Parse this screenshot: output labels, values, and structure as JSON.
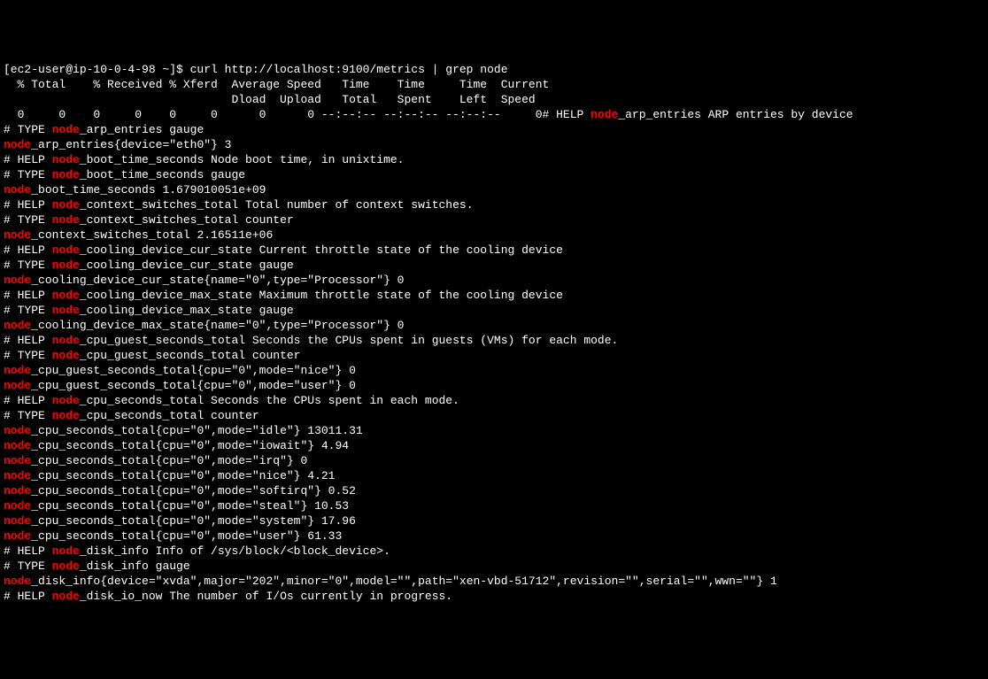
{
  "prompt": "[ec2-user@ip-10-0-4-98 ~]$ curl http://localhost:9100/metrics | grep node",
  "curl_headers": [
    "  % Total    % Received % Xferd  Average Speed   Time    Time     Time  Current",
    "                                 Dload  Upload   Total   Spent    Left  Speed"
  ],
  "curl_progress_left": "  0     0    0     0    0     0      0      0 --:--:-- --:--:-- --:--:--     0",
  "curl_progress_right_pre": "# HELP ",
  "curl_progress_right_post": "_arp_entries ARP entries by device",
  "lines": [
    {
      "pre": "# TYPE ",
      "hl": "node",
      "post": "_arp_entries gauge"
    },
    {
      "pre": "",
      "hl": "node",
      "post": "_arp_entries{device=\"eth0\"} 3"
    },
    {
      "pre": "# HELP ",
      "hl": "node",
      "post": "_boot_time_seconds Node boot time, in unixtime."
    },
    {
      "pre": "# TYPE ",
      "hl": "node",
      "post": "_boot_time_seconds gauge"
    },
    {
      "pre": "",
      "hl": "node",
      "post": "_boot_time_seconds 1.679010051e+09"
    },
    {
      "pre": "# HELP ",
      "hl": "node",
      "post": "_context_switches_total Total number of context switches."
    },
    {
      "pre": "# TYPE ",
      "hl": "node",
      "post": "_context_switches_total counter"
    },
    {
      "pre": "",
      "hl": "node",
      "post": "_context_switches_total 2.16511e+06"
    },
    {
      "pre": "# HELP ",
      "hl": "node",
      "post": "_cooling_device_cur_state Current throttle state of the cooling device"
    },
    {
      "pre": "# TYPE ",
      "hl": "node",
      "post": "_cooling_device_cur_state gauge"
    },
    {
      "pre": "",
      "hl": "node",
      "post": "_cooling_device_cur_state{name=\"0\",type=\"Processor\"} 0"
    },
    {
      "pre": "# HELP ",
      "hl": "node",
      "post": "_cooling_device_max_state Maximum throttle state of the cooling device"
    },
    {
      "pre": "# TYPE ",
      "hl": "node",
      "post": "_cooling_device_max_state gauge"
    },
    {
      "pre": "",
      "hl": "node",
      "post": "_cooling_device_max_state{name=\"0\",type=\"Processor\"} 0"
    },
    {
      "pre": "# HELP ",
      "hl": "node",
      "post": "_cpu_guest_seconds_total Seconds the CPUs spent in guests (VMs) for each mode."
    },
    {
      "pre": "# TYPE ",
      "hl": "node",
      "post": "_cpu_guest_seconds_total counter"
    },
    {
      "pre": "",
      "hl": "node",
      "post": "_cpu_guest_seconds_total{cpu=\"0\",mode=\"nice\"} 0"
    },
    {
      "pre": "",
      "hl": "node",
      "post": "_cpu_guest_seconds_total{cpu=\"0\",mode=\"user\"} 0"
    },
    {
      "pre": "# HELP ",
      "hl": "node",
      "post": "_cpu_seconds_total Seconds the CPUs spent in each mode."
    },
    {
      "pre": "# TYPE ",
      "hl": "node",
      "post": "_cpu_seconds_total counter"
    },
    {
      "pre": "",
      "hl": "node",
      "post": "_cpu_seconds_total{cpu=\"0\",mode=\"idle\"} 13011.31"
    },
    {
      "pre": "",
      "hl": "node",
      "post": "_cpu_seconds_total{cpu=\"0\",mode=\"iowait\"} 4.94"
    },
    {
      "pre": "",
      "hl": "node",
      "post": "_cpu_seconds_total{cpu=\"0\",mode=\"irq\"} 0"
    },
    {
      "pre": "",
      "hl": "node",
      "post": "_cpu_seconds_total{cpu=\"0\",mode=\"nice\"} 4.21"
    },
    {
      "pre": "",
      "hl": "node",
      "post": "_cpu_seconds_total{cpu=\"0\",mode=\"softirq\"} 0.52"
    },
    {
      "pre": "",
      "hl": "node",
      "post": "_cpu_seconds_total{cpu=\"0\",mode=\"steal\"} 10.53"
    },
    {
      "pre": "",
      "hl": "node",
      "post": "_cpu_seconds_total{cpu=\"0\",mode=\"system\"} 17.96"
    },
    {
      "pre": "",
      "hl": "node",
      "post": "_cpu_seconds_total{cpu=\"0\",mode=\"user\"} 61.33"
    },
    {
      "pre": "# HELP ",
      "hl": "node",
      "post": "_disk_info Info of /sys/block/<block_device>."
    },
    {
      "pre": "# TYPE ",
      "hl": "node",
      "post": "_disk_info gauge"
    },
    {
      "pre": "",
      "hl": "node",
      "post": "_disk_info{device=\"xvda\",major=\"202\",minor=\"0\",model=\"\",path=\"xen-vbd-51712\",revision=\"\",serial=\"\",wwn=\"\"} 1"
    },
    {
      "pre": "# HELP ",
      "hl": "node",
      "post": "_disk_io_now The number of I/Os currently in progress."
    }
  ]
}
